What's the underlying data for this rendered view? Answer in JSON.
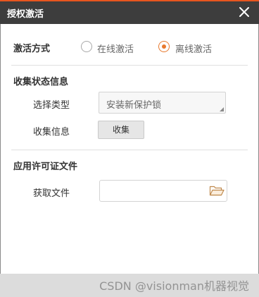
{
  "dialog": {
    "title": "授权激活",
    "close_icon": "close-icon"
  },
  "activation": {
    "label": "激活方式",
    "options": [
      {
        "label": "在线激活",
        "selected": false
      },
      {
        "label": "离线激活",
        "selected": true
      }
    ]
  },
  "collect": {
    "heading": "收集状态信息",
    "type_label": "选择类型",
    "type_value": "安装新保护锁",
    "info_label": "收集信息",
    "collect_button": "收集"
  },
  "license": {
    "heading": "应用许可证文件",
    "file_label": "获取文件",
    "file_value": "",
    "folder_icon": "folder-open-icon"
  },
  "watermark": "CSDN @visionman机器视觉",
  "colors": {
    "accent": "#e8792e",
    "titlebar": "#3d3d3d",
    "titlebar_border": "#e8561f",
    "footer": "#dcdcdc"
  }
}
